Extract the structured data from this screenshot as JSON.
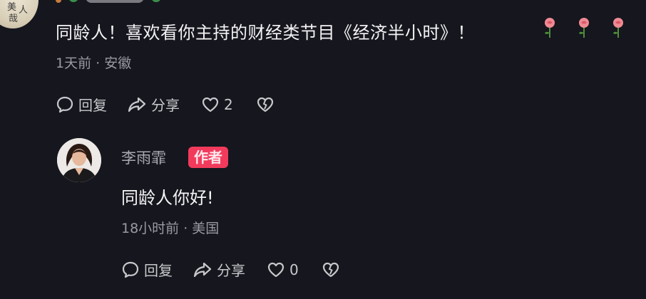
{
  "comment": {
    "text": "同龄人！喜欢看你主持的财经类节目《经济半小时》！",
    "meta": "1天前 · 安徽",
    "reply_label": "回复",
    "share_label": "分享",
    "like_count": "2",
    "reaction_count": 3
  },
  "reply": {
    "author": "李雨霏",
    "badge": "作者",
    "text": "同龄人你好!",
    "meta": "18小时前 · 美国",
    "reply_label": "回复",
    "share_label": "分享",
    "like_count": "0"
  },
  "colors": {
    "background": "#16161e",
    "badge": "#f23b5c",
    "meta_text": "#9a9aa2"
  },
  "icons": [
    "reply-bubble-icon",
    "share-arrow-icon",
    "heart-icon",
    "broken-heart-icon",
    "rose-icon"
  ]
}
